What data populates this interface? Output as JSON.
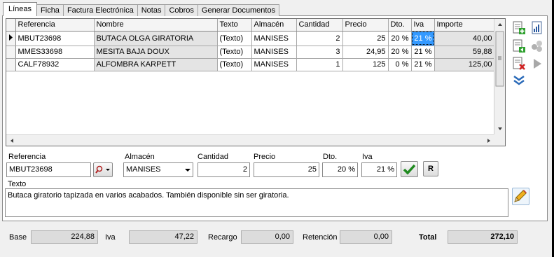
{
  "tabs": [
    "Líneas",
    "Ficha",
    "Factura Electrónica",
    "Notas",
    "Cobros",
    "Generar Documentos"
  ],
  "grid": {
    "columns": [
      "Referencia",
      "Nombre",
      "Texto",
      "Almacén",
      "Cantidad",
      "Precio",
      "Dto.",
      "Iva",
      "Importe"
    ],
    "rows": [
      {
        "ref": "MBUT23698",
        "nombre": "BUTACA OLGA GIRATORIA",
        "texto": "(Texto)",
        "almacen": "MANISES",
        "cantidad": "2",
        "precio": "25",
        "dto": "20 %",
        "iva": "21 %",
        "importe": "40,00"
      },
      {
        "ref": "MMES33698",
        "nombre": "MESITA BAJA DOUX",
        "texto": "(Texto)",
        "almacen": "MANISES",
        "cantidad": "3",
        "precio": "24,95",
        "dto": "20 %",
        "iva": "21 %",
        "importe": "59,88"
      },
      {
        "ref": "CALF78932",
        "nombre": "ALFOMBRA KARPETT",
        "texto": "(Texto)",
        "almacen": "MANISES",
        "cantidad": "1",
        "precio": "125",
        "dto": "0 %",
        "iva": "21 %",
        "importe": "125,00"
      }
    ]
  },
  "form": {
    "referencia_label": "Referencia",
    "referencia_value": "MBUT23698",
    "almacen_label": "Almacén",
    "almacen_value": "MANISES",
    "cantidad_label": "Cantidad",
    "cantidad_value": "2",
    "precio_label": "Precio",
    "precio_value": "25",
    "dto_label": "Dto.",
    "dto_value": "20 %",
    "iva_label": "Iva",
    "iva_value": "21 %",
    "r_button": "R",
    "texto_label": "Texto",
    "texto_value": "Butaca giratorio tapizada en varios acabados. También disponible sin ser giratoria."
  },
  "totals": {
    "base_label": "Base",
    "base_value": "224,88",
    "iva_label": "Iva",
    "iva_value": "47,22",
    "recargo_label": "Recargo",
    "recargo_value": "0,00",
    "retencion_label": "Retención",
    "retencion_value": "0,00",
    "total_label": "Total",
    "total_value": "272,10"
  },
  "icons": [
    "add-line-icon",
    "report-icon",
    "insert-line-icon",
    "group-icon",
    "delete-line-icon",
    "play-icon",
    "expand-down-icon",
    "search-icon",
    "confirm-icon",
    "edit-icon"
  ]
}
